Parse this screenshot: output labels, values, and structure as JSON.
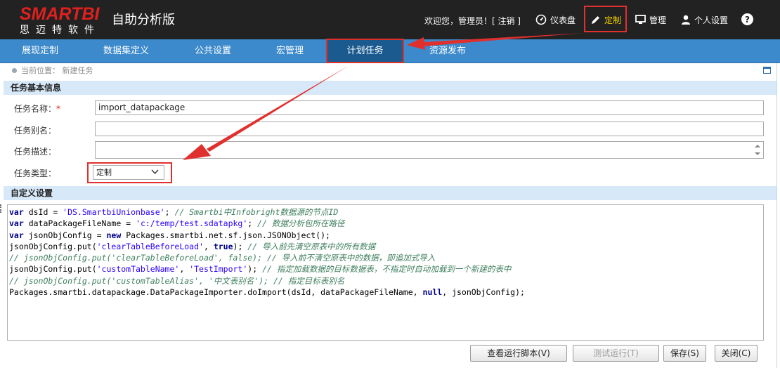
{
  "header": {
    "logo_main": "SMARTBI",
    "logo_sub": "思迈特软件",
    "app_title": "自助分析版",
    "welcome": "欢迎您，管理员！[ 注销 ]",
    "dashboard": "仪表盘",
    "custom": "定制",
    "manage": "管理",
    "personal": "个人设置",
    "help": "?"
  },
  "nav": {
    "items": [
      "展现定制",
      "数据集定义",
      "公共设置",
      "宏管理",
      "计划任务",
      "资源发布"
    ],
    "active": "计划任务"
  },
  "breadcrumb": {
    "text": "当前位置： 新建任务"
  },
  "basic_info": {
    "title": "任务基本信息",
    "name_label": "任务名称：",
    "name_required": "*",
    "name_value": "import_datapackage",
    "alias_label": "任务别名：",
    "alias_value": "",
    "desc_label": "任务描述：",
    "desc_value": "",
    "type_label": "任务类型：",
    "type_value": "定制"
  },
  "custom_settings": {
    "title": "自定义设置",
    "code_lines": [
      "var dsId = 'DS.SmartbiUnionbase'; // Smartbi中Infobright数据源的节点ID",
      "var dataPackageFileName = 'c:/temp/test.sdatapkg'; // 数据分析包所在路径",
      "var jsonObjConfig = new Packages.smartbi.net.sf.json.JSONObject();",
      "jsonObjConfig.put('clearTableBeforeLoad', true); // 导入前先清空原表中的所有数据",
      "// jsonObjConfig.put('clearTableBeforeLoad', false); // 导入前不清空原表中的数据，即追加式导入",
      "jsonObjConfig.put('customTableName', 'TestImport'); // 指定加载数据的目标数据表，不指定时自动加载到一个新建的表中",
      "// jsonObjConfig.put('customTableAlias', '中文表别名'); // 指定目标表别名",
      "Packages.smartbi.datapackage.DataPackageImporter.doImport(dsId, dataPackageFileName, null, jsonObjConfig);"
    ]
  },
  "buttons": {
    "view_script": "查看运行脚本(V)",
    "test_run": "测试运行(T)",
    "save": "保存(S)",
    "close": "关闭(C)"
  },
  "colors": {
    "header_bg": "#222222",
    "nav_bg": "#3c8acb",
    "nav_active": "#1b5a8f",
    "section_bg": "#d7e8f8",
    "annotation_red": "#e0302e",
    "logo_red": "#e0201e",
    "custom_highlight": "#f5d100"
  }
}
